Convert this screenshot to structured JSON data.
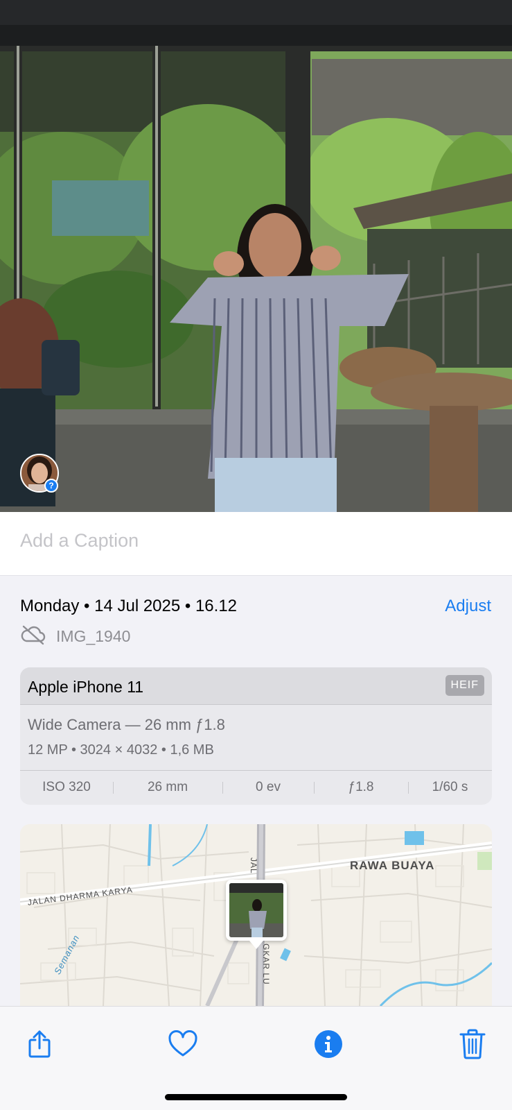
{
  "caption": {
    "placeholder": "Add a Caption",
    "value": ""
  },
  "info": {
    "date_time": "Monday • 14 Jul 2025 • 16.12",
    "adjust_label": "Adjust",
    "filename": "IMG_1940",
    "cloud_status_icon": "cloud-slash-icon"
  },
  "camera": {
    "model": "Apple iPhone 11",
    "format_badge": "HEIF",
    "lens": "Wide Camera — 26 mm ƒ1.8",
    "specs": "12 MP  •  3024 × 4032  •  1,6 MB",
    "exif": [
      {
        "label": "ISO 320"
      },
      {
        "label": "26 mm"
      },
      {
        "label": "0 ev"
      },
      {
        "label": "ƒ1.8"
      },
      {
        "label": "1/60 s"
      }
    ]
  },
  "map": {
    "labels": {
      "district": "RAWA BUAYA",
      "street_dharma": "JALAN DHARMA KARYA",
      "street_semanan": "Semanan",
      "street_vertical_top": "JAL",
      "street_vertical_bottom": "GKAR LU"
    }
  },
  "people": {
    "unconfirmed_badge": "?"
  },
  "toolbar": {
    "buttons": [
      {
        "name": "share",
        "icon": "share-icon"
      },
      {
        "name": "favorite",
        "icon": "heart-icon"
      },
      {
        "name": "info",
        "icon": "info-icon",
        "active": true
      },
      {
        "name": "delete",
        "icon": "trash-icon"
      }
    ]
  },
  "colors": {
    "accent": "#1a7df0",
    "background": "#f2f2f7",
    "secondary_text": "#8e8e93"
  }
}
